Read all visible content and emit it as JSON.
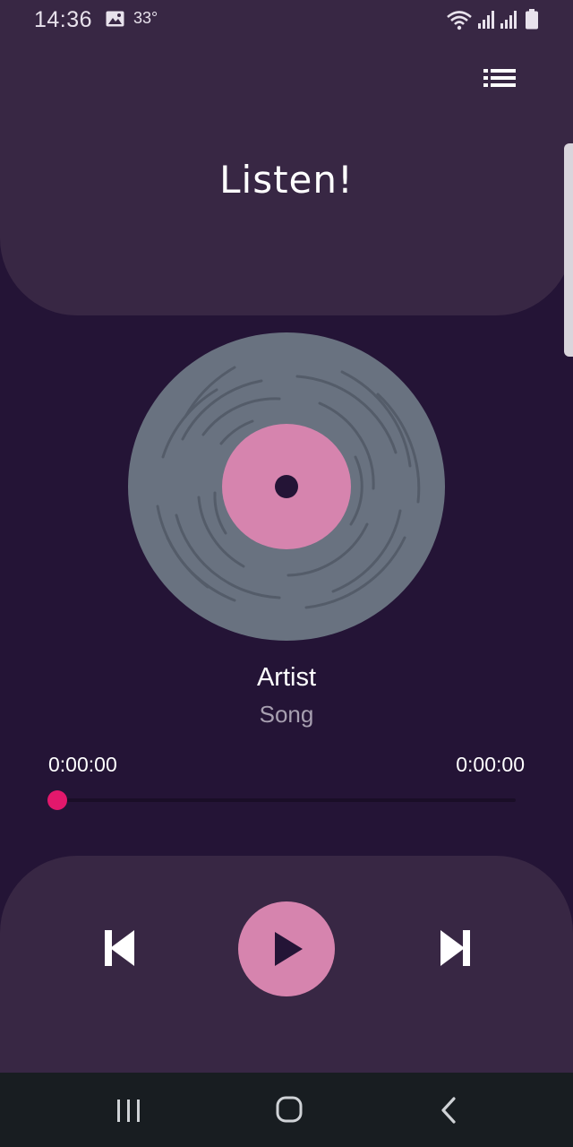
{
  "status_bar": {
    "time": "14:36",
    "temperature": "33°",
    "icons": [
      "gallery-icon",
      "wifi-icon",
      "signal-icon",
      "signal-icon",
      "battery-icon"
    ]
  },
  "header": {
    "title": "Listen!",
    "menu_icon": "playlist-menu-icon"
  },
  "track": {
    "artist": "Artist",
    "song": "Song",
    "elapsed": "0:00:00",
    "duration": "0:00:00",
    "progress": 0
  },
  "controls": {
    "previous_icon": "skip-previous-icon",
    "play_icon": "play-icon",
    "next_icon": "skip-next-icon"
  },
  "nav_bar": {
    "icons": [
      "recents-icon",
      "home-icon",
      "back-icon"
    ]
  },
  "colors": {
    "background": "#241436",
    "card": "#382744",
    "accent": "#e3186c",
    "play_button": "#d684ae",
    "vinyl": "#697280",
    "vinyl_label": "#d684ae"
  }
}
